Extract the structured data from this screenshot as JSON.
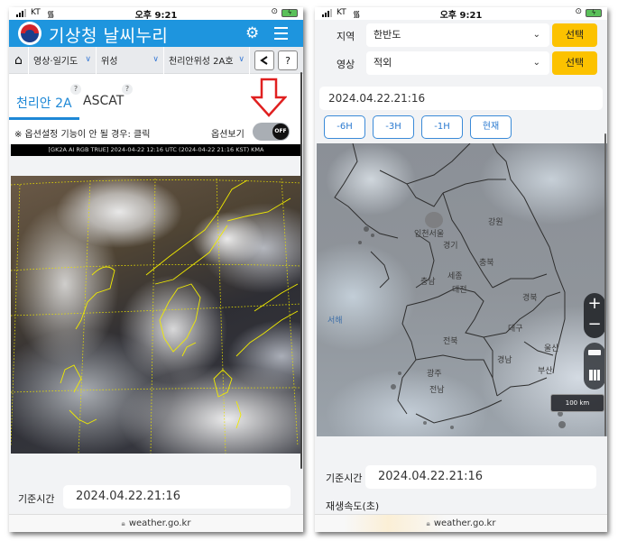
{
  "status_bar": {
    "carrier": "KT",
    "time": "오후 9:21"
  },
  "left": {
    "header": {
      "title": "기상청 날씨누리",
      "settings_icon": "gear-icon",
      "menu_icon": "hamburger-menu-icon"
    },
    "nav": {
      "home_icon": "home-icon",
      "segments": [
        {
          "label": "영상·일기도"
        },
        {
          "label": "위성"
        },
        {
          "label": "천리안위성 2A호"
        }
      ],
      "share_icon": "share-icon",
      "help_label": "?"
    },
    "tabs": [
      {
        "label": "천리안 2A",
        "active": true,
        "help": "?"
      },
      {
        "label": "ASCAT",
        "active": false,
        "help": "?"
      }
    ],
    "options": {
      "note": "※ 옵션설정 기능이 안 될 경우: 클릭",
      "toggle_label": "옵션보기",
      "toggle_state": "OFF"
    },
    "satellite": {
      "caption": "[GK2A AI RGB TRUE] 2024-04-22 12:16 UTC (2024-04-22 21:16 KST) KMA"
    },
    "reference_time": {
      "label": "기준시간",
      "value": "2024.04.22.21:16"
    },
    "url": "weather.go.kr"
  },
  "right": {
    "region": {
      "label": "지역",
      "value": "한반도",
      "button": "선택"
    },
    "image_type": {
      "label": "영상",
      "value": "적외",
      "button": "선택"
    },
    "time_value": "2024.04.22.21:16",
    "time_buttons": [
      "-6H",
      "-3H",
      "-1H",
      "현재"
    ],
    "map": {
      "labels": {
        "gangwon": "강원",
        "incheon_seoul": "인천서울",
        "gyeonggi": "경기",
        "chungbuk": "충북",
        "chungnam": "충남",
        "sejong": "세종",
        "daejeon": "대전",
        "gyeongbuk": "경북",
        "daegu": "대구",
        "jeonbuk": "전북",
        "ulsan": "울산",
        "gyeongnam": "경남",
        "busan": "부산",
        "gwangju": "광주",
        "jeonnam": "전남",
        "west_sea": "서해"
      },
      "zoom_in": "+",
      "zoom_out": "−",
      "scale": "100 km"
    },
    "reference_time": {
      "label": "기준시간",
      "value": "2024.04.22.21:16"
    },
    "playback_speed_label": "재생속도(초)",
    "url": "weather.go.kr"
  }
}
